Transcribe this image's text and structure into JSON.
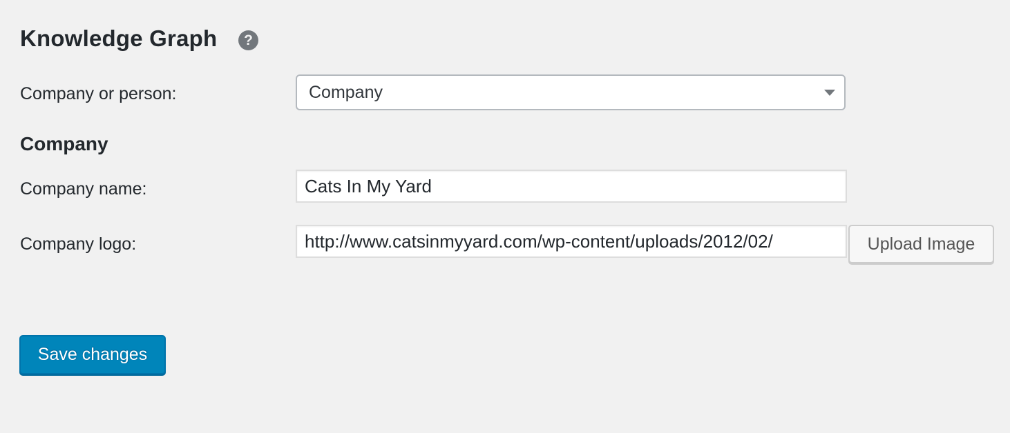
{
  "knowledge_graph": {
    "title": "Knowledge Graph",
    "help_glyph": "?",
    "help_icon": "question-mark-circle-icon",
    "company_or_person": {
      "label": "Company or person:",
      "selected": "Company",
      "arrow_icon": "triangle-down-icon"
    }
  },
  "company": {
    "heading": "Company",
    "name": {
      "label": "Company name:",
      "value": "Cats In My Yard"
    },
    "logo": {
      "label": "Company logo:",
      "value": "http://www.catsinmyyard.com/wp-content/uploads/2012/02/",
      "upload_button": "Upload Image"
    }
  },
  "actions": {
    "save_label": "Save changes"
  },
  "colors": {
    "background": "#f1f1f1",
    "primary_button": "#0085ba",
    "help_icon": "#72777c"
  }
}
